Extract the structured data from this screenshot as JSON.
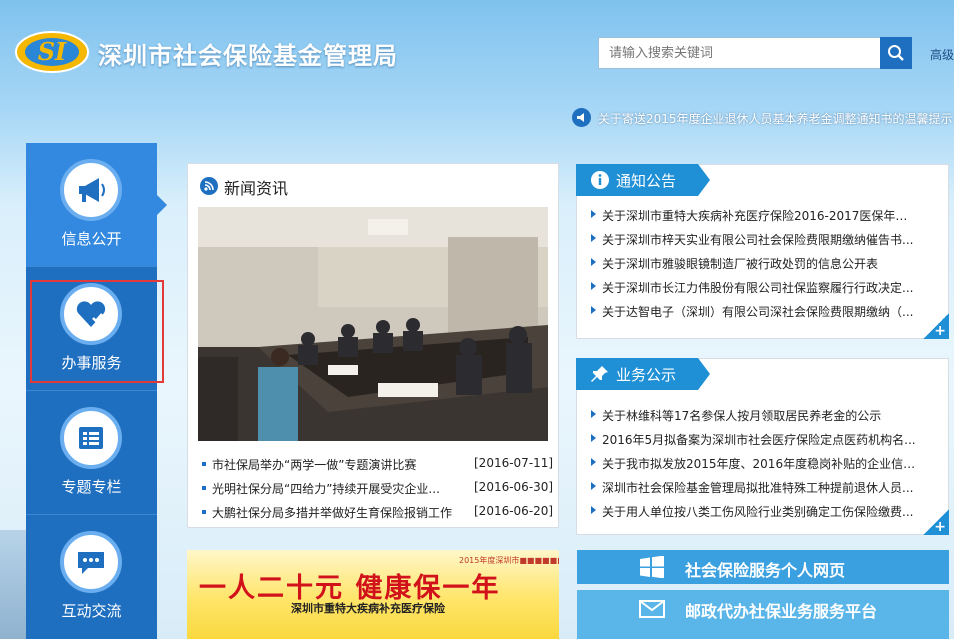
{
  "header": {
    "logo_text": "深圳市社会保险基金管理局",
    "logo_mark": "SI",
    "search_placeholder": "请输入搜索关键词",
    "advanced_search": "高级",
    "marquee": "关于寄送2015年度企业退休人员基本养老金调整通知书的温馨提示"
  },
  "nav": {
    "items": [
      {
        "label": "信息公开",
        "icon": "megaphone-icon"
      },
      {
        "label": "办事服务",
        "icon": "heart-icon"
      },
      {
        "label": "专题专栏",
        "icon": "list-icon"
      },
      {
        "label": "互动交流",
        "icon": "chat-icon"
      }
    ]
  },
  "news": {
    "title": "新闻资讯",
    "slide_count": 4,
    "active_slide": 4,
    "items": [
      {
        "title": "市社保局举办“两学一做”专题演讲比赛",
        "date": "[2016-07-11]"
      },
      {
        "title": "光明社保分局“四给力”持续开展受灾企业...",
        "date": "[2016-06-30]"
      },
      {
        "title": "大鹏社保分局多措并举做好生育保险报销工作",
        "date": "[2016-06-20]"
      }
    ]
  },
  "notices": {
    "title": "通知公告",
    "more": "+",
    "items": [
      "关于深圳市重特大疾病补充医疗保险2016-2017医保年度...",
      "关于深圳市梓天实业有限公司社会保险费限期缴纳催告书...",
      "关于深圳市雅骏眼镜制造厂被行政处罚的信息公开表",
      "关于深圳市长江力伟股份有限公司社保监察履行行政决定...",
      "关于达智电子（深圳）有限公司深社会保险费限期缴纳（..."
    ]
  },
  "business": {
    "title": "业务公示",
    "more": "+",
    "items": [
      "关于林维科等17名参保人按月领取居民养老金的公示",
      "2016年5月拟备案为深圳市社会医疗保险定点医药机构名...",
      "关于我市拟发放2015年度、2016年度稳岗补贴的企业信息...",
      "深圳市社会保险基金管理局拟批准特殊工种提前退休人员...",
      "关于用人单位按八类工伤风险行业类别确定工伤保险缴费..."
    ]
  },
  "banner": {
    "top": "2015年度深圳市■■■■■■",
    "big": "一人二十元  健康保一年",
    "sub": "深圳市重特大疾病补充医疗保险"
  },
  "services": [
    {
      "label": "社会保险服务个人网页",
      "icon": "windows-icon"
    },
    {
      "label": "邮政代办社保业务服务平台",
      "icon": "mail-icon"
    }
  ],
  "colors": {
    "primary": "#1f6fc0",
    "accent": "#1f8fd6",
    "highlight": "#e23a3a"
  }
}
